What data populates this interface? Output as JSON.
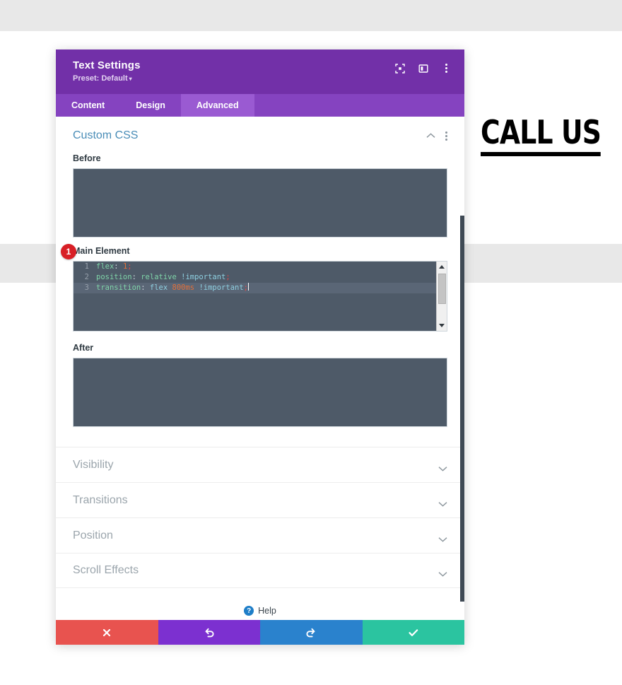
{
  "page": {
    "call_us_heading": "CALL US"
  },
  "modal": {
    "title": "Text Settings",
    "preset_label": "Preset: Default",
    "preset_caret": "▾",
    "header_icons": [
      {
        "name": "focus-target-icon",
        "glyph": "focus"
      },
      {
        "name": "layout-panel-icon",
        "glyph": "panel"
      },
      {
        "name": "more-options-icon",
        "glyph": "dots"
      }
    ],
    "tabs": [
      {
        "label": "Content",
        "active": false
      },
      {
        "label": "Design",
        "active": false
      },
      {
        "label": "Advanced",
        "active": true
      }
    ],
    "section": {
      "title": "Custom CSS",
      "collapse_icon": "chevron-up",
      "options_icon": "dots-vertical"
    },
    "fields": [
      {
        "label": "Before",
        "value": ""
      },
      {
        "label": "Main Element",
        "value": "flex: 1;\nposition: relative !important;\ntransition: flex 800ms !important;"
      },
      {
        "label": "After",
        "value": ""
      }
    ],
    "code_editor": {
      "step_badge": "1",
      "lines": [
        {
          "number": "1",
          "highlighted": false,
          "tokens": [
            {
              "text": "flex",
              "type": "prop"
            },
            {
              "text": ": ",
              "type": "plain"
            },
            {
              "text": "1",
              "type": "num"
            },
            {
              "text": ";",
              "type": "punc"
            }
          ]
        },
        {
          "number": "2",
          "highlighted": false,
          "tokens": [
            {
              "text": "position",
              "type": "prop"
            },
            {
              "text": ": ",
              "type": "plain"
            },
            {
              "text": "relative",
              "type": "val"
            },
            {
              "text": " ",
              "type": "plain"
            },
            {
              "text": "!important",
              "type": "imp"
            },
            {
              "text": ";",
              "type": "punc"
            }
          ]
        },
        {
          "number": "3",
          "highlighted": true,
          "tokens": [
            {
              "text": "transition",
              "type": "prop"
            },
            {
              "text": ": ",
              "type": "plain"
            },
            {
              "text": "flex",
              "type": "imp"
            },
            {
              "text": " ",
              "type": "plain"
            },
            {
              "text": "800ms",
              "type": "num"
            },
            {
              "text": " ",
              "type": "plain"
            },
            {
              "text": "!important",
              "type": "imp"
            },
            {
              "text": ";",
              "type": "punc"
            }
          ]
        }
      ]
    },
    "collapsed_sections": [
      {
        "label": "Visibility"
      },
      {
        "label": "Transitions"
      },
      {
        "label": "Position"
      },
      {
        "label": "Scroll Effects"
      }
    ],
    "help": {
      "icon_glyph": "?",
      "label": "Help"
    },
    "footer_buttons": [
      {
        "name": "cancel-button",
        "glyph": "✖",
        "color": "#e8534f"
      },
      {
        "name": "undo-button",
        "glyph": "↺",
        "color": "#7c30d0"
      },
      {
        "name": "redo-button",
        "glyph": "↻",
        "color": "#2a82cd"
      },
      {
        "name": "save-button",
        "glyph": "✔",
        "color": "#2bc4a0"
      }
    ]
  },
  "colors": {
    "header_purple": "#7230a8",
    "tabs_purple": "#8543c0",
    "tab_active_purple": "#9a5ad2",
    "section_title_blue": "#4a8db7",
    "code_bg": "#4e5a68",
    "badge_red": "#d81f26"
  }
}
